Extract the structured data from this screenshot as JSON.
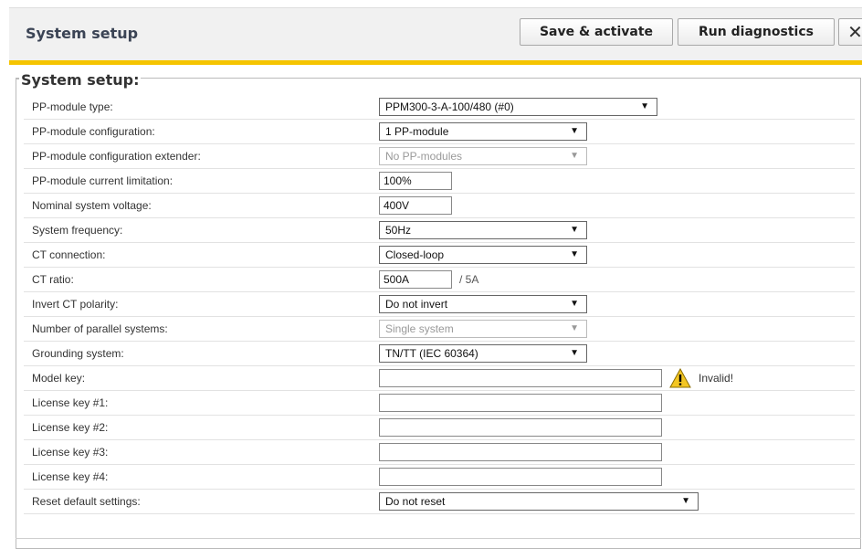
{
  "header": {
    "title": "System setup",
    "save_label": "Save & activate",
    "diagnostics_label": "Run diagnostics",
    "close_label": "✕",
    "accent_color": "#f5c400"
  },
  "section": {
    "legend": "System setup:"
  },
  "fields": {
    "pp_module_type": {
      "label": "PP-module type:",
      "value": "PPM300-3-A-100/480 (#0)"
    },
    "pp_module_config": {
      "label": "PP-module configuration:",
      "value": "1 PP-module"
    },
    "pp_module_config_ext": {
      "label": "PP-module configuration extender:",
      "value": "No PP-modules"
    },
    "pp_module_current_limit": {
      "label": "PP-module current limitation:",
      "value": "100%"
    },
    "nominal_voltage": {
      "label": "Nominal system voltage:",
      "value": "400V"
    },
    "system_frequency": {
      "label": "System frequency:",
      "value": "50Hz"
    },
    "ct_connection": {
      "label": "CT connection:",
      "value": "Closed-loop"
    },
    "ct_ratio": {
      "label": "CT ratio:",
      "value": "500A",
      "suffix": "/ 5A"
    },
    "invert_ct_polarity": {
      "label": "Invert CT polarity:",
      "value": "Do not invert"
    },
    "parallel_systems": {
      "label": "Number of parallel systems:",
      "value": "Single system"
    },
    "grounding_system": {
      "label": "Grounding system:",
      "value": "TN/TT (IEC 60364)"
    },
    "model_key": {
      "label": "Model key:",
      "value": "",
      "status": "Invalid!"
    },
    "license_key_1": {
      "label": "License key #1:",
      "value": ""
    },
    "license_key_2": {
      "label": "License key #2:",
      "value": ""
    },
    "license_key_3": {
      "label": "License key #3:",
      "value": ""
    },
    "license_key_4": {
      "label": "License key #4:",
      "value": ""
    },
    "reset_defaults": {
      "label": "Reset default settings:",
      "value": "Do not reset"
    }
  }
}
